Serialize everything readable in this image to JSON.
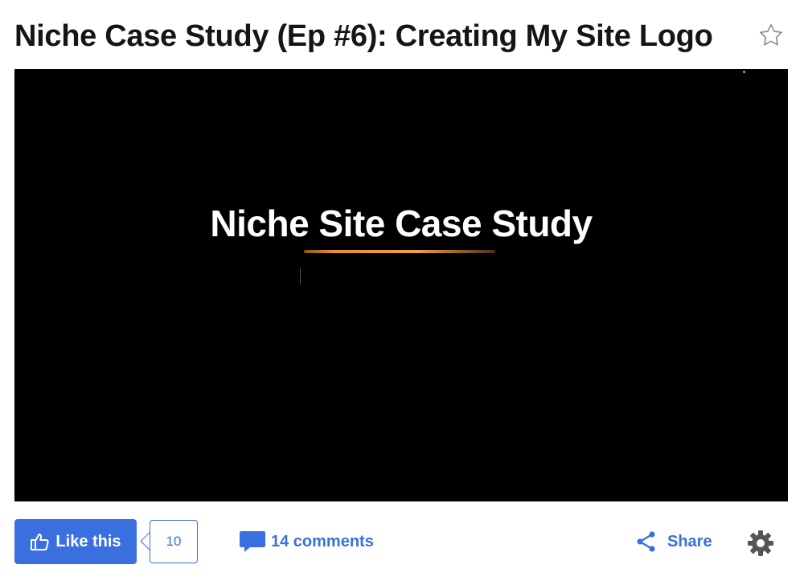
{
  "header": {
    "title": "Niche Case Study (Ep #6): Creating My Site Logo",
    "favorite_icon": "star-outline-icon"
  },
  "video": {
    "overlay_title": "Niche Site Case Study",
    "background_color": "#000000",
    "accent_color": "#e98f30"
  },
  "actions": {
    "like_label": "Like this",
    "like_icon": "thumbs-up-icon",
    "like_count": "10",
    "comments_label": "14 comments",
    "comments_icon": "speech-bubble-icon",
    "share_label": "Share",
    "share_icon": "share-icon",
    "settings_icon": "gear-icon",
    "accent_color": "#3a6fe0"
  }
}
